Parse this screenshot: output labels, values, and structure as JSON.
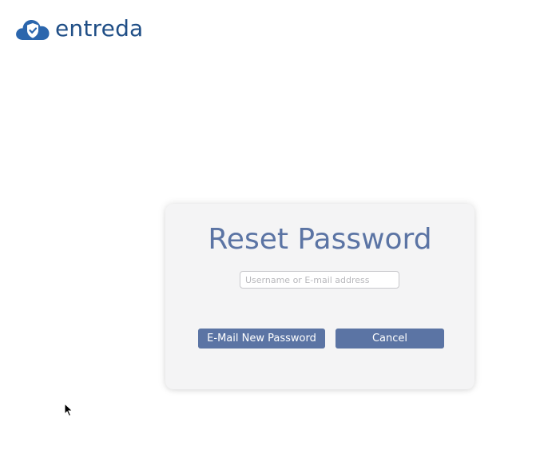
{
  "brand": {
    "name": "entreda",
    "logo_icon": "cloud-shield-icon",
    "text_color": "#1f4e86",
    "icon_color": "#2b66ad"
  },
  "reset_form": {
    "title": "Reset Password",
    "username_input": {
      "value": "",
      "placeholder": "Username or E-mail address"
    },
    "email_button_label": "E-Mail New Password",
    "cancel_button_label": "Cancel",
    "accent_color": "#5b74a4"
  }
}
